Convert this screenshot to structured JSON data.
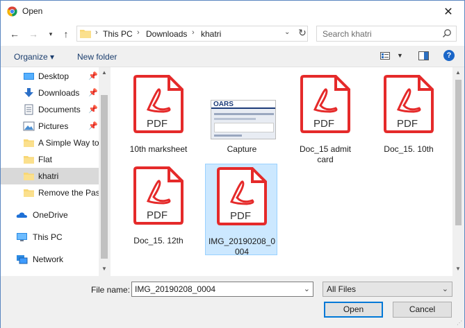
{
  "window": {
    "title": "Open"
  },
  "address": {
    "crumbs": [
      "This PC",
      "Downloads",
      "khatri"
    ]
  },
  "search": {
    "placeholder": "Search khatri"
  },
  "toolbar": {
    "organize_label": "Organize ▾",
    "new_folder_label": "New folder"
  },
  "nav": {
    "items": [
      {
        "label": "Desktop",
        "icon": "desktop-icon",
        "pinned": true
      },
      {
        "label": "Downloads",
        "icon": "downloads-icon",
        "pinned": true
      },
      {
        "label": "Documents",
        "icon": "documents-icon",
        "pinned": true
      },
      {
        "label": "Pictures",
        "icon": "pictures-icon",
        "pinned": true
      },
      {
        "label": "A Simple Way to",
        "icon": "folder-icon",
        "pinned": false
      },
      {
        "label": "Flat",
        "icon": "folder-icon",
        "pinned": false
      },
      {
        "label": "khatri",
        "icon": "folder-icon",
        "pinned": false,
        "selected": true
      },
      {
        "label": "Remove the Pass",
        "icon": "folder-icon",
        "pinned": false
      },
      {
        "label": "OneDrive",
        "icon": "onedrive-icon"
      },
      {
        "label": "This PC",
        "icon": "this-pc-icon"
      },
      {
        "label": "Network",
        "icon": "network-icon"
      }
    ]
  },
  "files": [
    {
      "name": "10th marksheet",
      "type": "pdf"
    },
    {
      "name": "Capture",
      "type": "image"
    },
    {
      "name": "Doc_15 admit card",
      "type": "pdf"
    },
    {
      "name": "Doc_15. 10th",
      "type": "pdf"
    },
    {
      "name": "Doc_15. 12th",
      "type": "pdf"
    },
    {
      "name": "IMG_20190208_0004",
      "type": "pdf",
      "selected": true
    }
  ],
  "pdf_badge": "PDF",
  "capture_brand": "OARS",
  "bottom": {
    "file_name_label": "File name:",
    "file_name_value": "IMG_20190208_0004",
    "file_type_value": "All Files",
    "open_label": "Open",
    "cancel_label": "Cancel"
  },
  "colors": {
    "pdf_red": "#e52a2a",
    "selection": "#cce8ff",
    "accent": "#0078d7"
  }
}
